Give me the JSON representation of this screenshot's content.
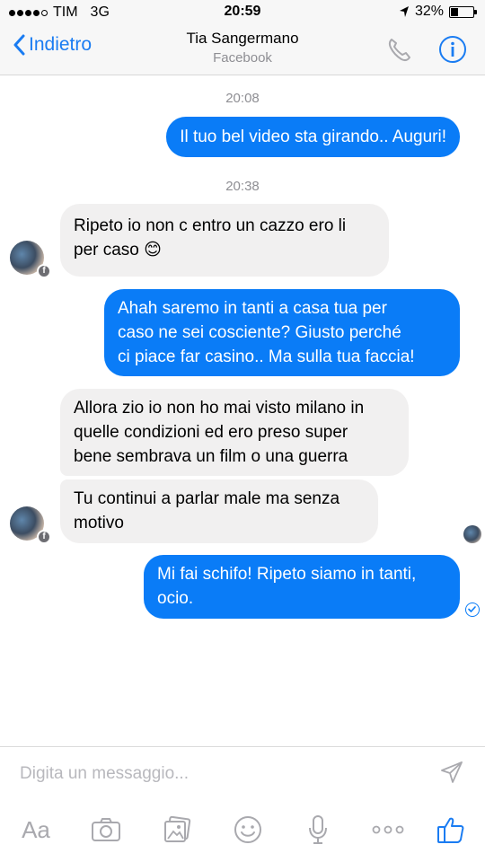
{
  "status_bar": {
    "carrier": "TIM",
    "network": "3G",
    "time": "20:59",
    "battery": "32%",
    "battery_level": 0.32
  },
  "header": {
    "back_label": "Indietro",
    "title": "Tia Sangermano",
    "subtitle": "Facebook"
  },
  "conversation": {
    "timestamps": [
      "20:08",
      "20:38"
    ],
    "messages": [
      {
        "direction": "outgoing",
        "lines": [
          "Il tuo bel video sta girando.. Auguri!"
        ]
      },
      {
        "direction": "incoming",
        "lines": [
          "Ripeto io non c entro un cazzo ero li",
          "per caso 😊"
        ]
      },
      {
        "direction": "outgoing",
        "lines": [
          "Ahah saremo in tanti a casa tua per",
          "caso ne sei cosciente? Giusto perché",
          "ci piace far casino.. Ma sulla tua faccia!"
        ]
      },
      {
        "direction": "incoming",
        "lines": [
          "Allora zio io non ho mai visto milano in",
          "quelle condizioni ed ero preso super",
          "bene sembrava un film o una guerra"
        ]
      },
      {
        "direction": "incoming",
        "lines": [
          "Tu continui a parlar male ma senza",
          "motivo"
        ]
      },
      {
        "direction": "outgoing",
        "lines": [
          "Mi fai schifo! Ripeto siamo in tanti,",
          "ocio."
        ]
      }
    ]
  },
  "composer": {
    "placeholder": "Digita un messaggio...",
    "aa_label": "Aa"
  },
  "icons": {
    "back": "chevron-left-icon",
    "call": "phone-icon",
    "info": "info-icon",
    "send": "send-icon",
    "camera": "camera-icon",
    "gallery": "gallery-icon",
    "emoji": "emoji-icon",
    "mic": "microphone-icon",
    "more": "more-icon",
    "like": "thumbs-up-icon"
  },
  "colors": {
    "accent": "#1a7cf2",
    "outgoing_bubble": "#0a7cf7",
    "incoming_bubble": "#f1f0f0",
    "secondary_text": "#8e8e93"
  }
}
